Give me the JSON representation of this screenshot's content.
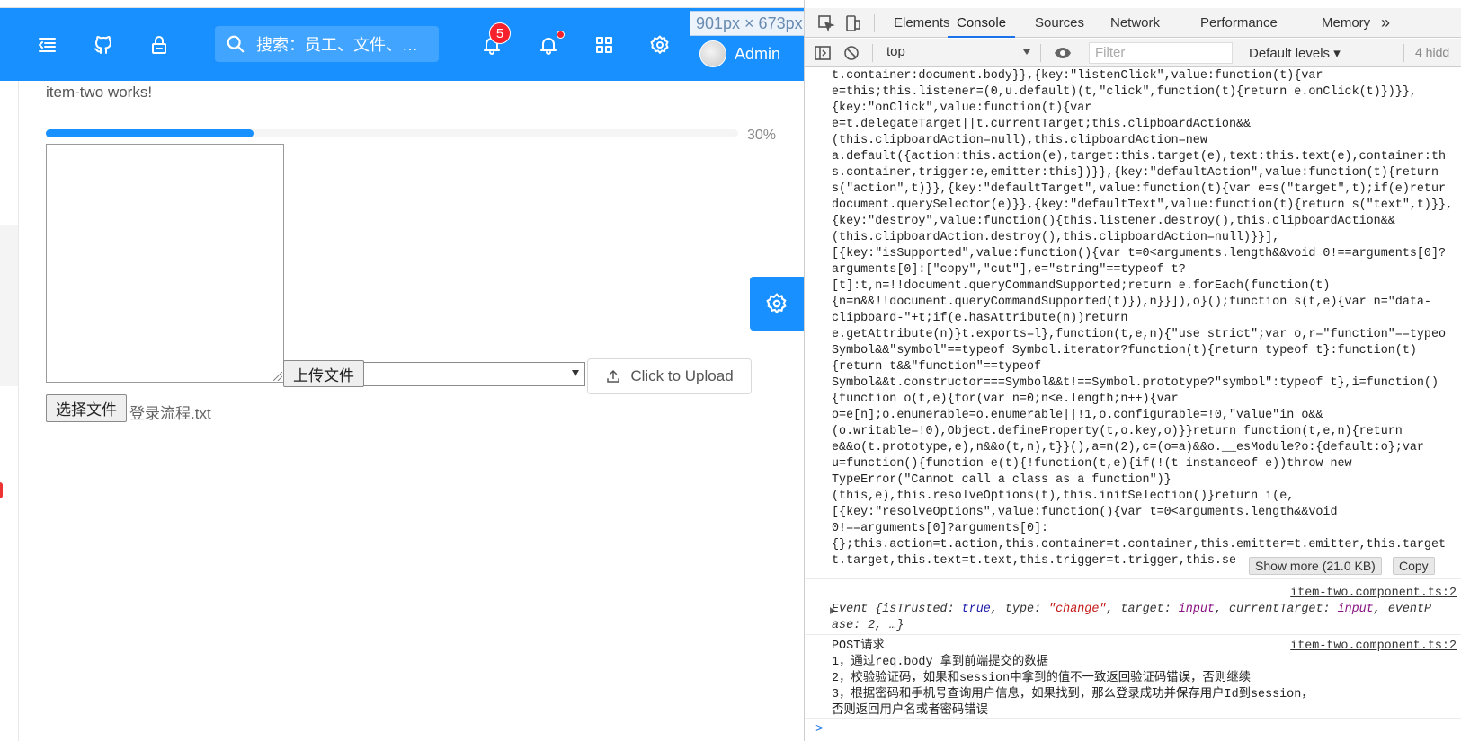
{
  "header": {
    "search_placeholder": "搜索：员工、文件、…",
    "notification_count": "5",
    "user_name": "Admin",
    "size_tooltip": "901px × 673px"
  },
  "main": {
    "content_text": "item-two works!",
    "progress": {
      "percent": 30,
      "label": "30%"
    },
    "upload_button_label": "上传文件",
    "click_upload_label": "Click to Upload",
    "choose_file_label": "选择文件",
    "chosen_file_name": "登录流程.txt"
  },
  "devtools": {
    "tabs": [
      "Elements",
      "Console",
      "Sources",
      "Network",
      "Performance",
      "Memory"
    ],
    "more_tabs": "»",
    "active_tab": "Console",
    "context": "top",
    "filter_placeholder": "Filter",
    "levels_label": "Default levels ▾",
    "hidden_label": "4 hidd",
    "code_lines": [
      "t.container:document.body}},{key:\"listenClick\",value:function(t){var",
      "e=this;this.listener=(0,u.default)(t,\"click\",function(t){return e.onClick(t)})}},",
      "{key:\"onClick\",value:function(t){var",
      "e=t.delegateTarget||t.currentTarget;this.clipboardAction&&",
      "(this.clipboardAction=null),this.clipboardAction=new",
      "a.default({action:this.action(e),target:this.target(e),text:this.text(e),container:th",
      "s.container,trigger:e,emitter:this})}},{key:\"defaultAction\",value:function(t){return",
      "s(\"action\",t)}},{key:\"defaultTarget\",value:function(t){var e=s(\"target\",t);if(e)retur",
      "document.querySelector(e)}},{key:\"defaultText\",value:function(t){return s(\"text\",t)}},",
      "{key:\"destroy\",value:function(){this.listener.destroy(),this.clipboardAction&&",
      "(this.clipboardAction.destroy(),this.clipboardAction=null)}}],",
      "[{key:\"isSupported\",value:function(){var t=0<arguments.length&&void 0!==arguments[0]?",
      "arguments[0]:[\"copy\",\"cut\"],e=\"string\"==typeof t?",
      "[t]:t,n=!!document.queryCommandSupported;return e.forEach(function(t)",
      "{n=n&&!!document.queryCommandSupported(t)}),n}}]),o}();function s(t,e){var n=\"data-",
      "clipboard-\"+t;if(e.hasAttribute(n))return",
      "e.getAttribute(n)}t.exports=l},function(t,e,n){\"use strict\";var o,r=\"function\"==typeo",
      "Symbol&&\"symbol\"==typeof Symbol.iterator?function(t){return typeof t}:function(t)",
      "{return t&&\"function\"==typeof",
      "Symbol&&t.constructor===Symbol&&t!==Symbol.prototype?\"symbol\":typeof t},i=function()",
      "{function o(t,e){for(var n=0;n<e.length;n++){var",
      "o=e[n];o.enumerable=o.enumerable||!1,o.configurable=!0,\"value\"in o&&",
      "(o.writable=!0),Object.defineProperty(t,o.key,o)}}return function(t,e,n){return",
      "e&&o(t.prototype,e),n&&o(t,n),t}}(),a=n(2),c=(o=a)&&o.__esModule?o:{default:o};var",
      "u=function(){function e(t){!function(t,e){if(!(t instanceof e))throw new",
      "TypeError(\"Cannot call a class as a function\")}",
      "(this,e),this.resolveOptions(t),this.initSelection()}return i(e,",
      "[{key:\"resolveOptions\",value:function(){var t=0<arguments.length&&void",
      "0!==arguments[0]?arguments[0]:",
      "{};this.action=t.action,this.container=t.container,this.emitter=t.emitter,this.target",
      "t.target,this.text=t.text,this.trigger=t.trigger,this.se"
    ],
    "show_more_label": "Show more (21.0 KB)",
    "copy_label": "Copy",
    "source_link": "item-two.component.ts:2",
    "event_line1_prefix": "Event {isTrusted: ",
    "event_true": "true",
    "event_type_key": ", type: ",
    "event_change": "\"change\"",
    "event_target_key": ", target: ",
    "event_input": "input",
    "event_current_key": ", currentTarget: ",
    "event_input2": "input",
    "event_phase_key": ", eventP",
    "event_line2": "ase: 2, …}",
    "message_lines": [
      "POST请求",
      "1，通过req.body 拿到前端提交的数据",
      "2，校验验证码，如果和session中拿到的值不一致返回验证码错误，否则继续",
      "3，根据密码和手机号查询用户信息，如果找到，那么登录成功并保存用户Id到session，",
      "否则返回用户名或者密码错误"
    ],
    "prompt_symbol": ">"
  }
}
